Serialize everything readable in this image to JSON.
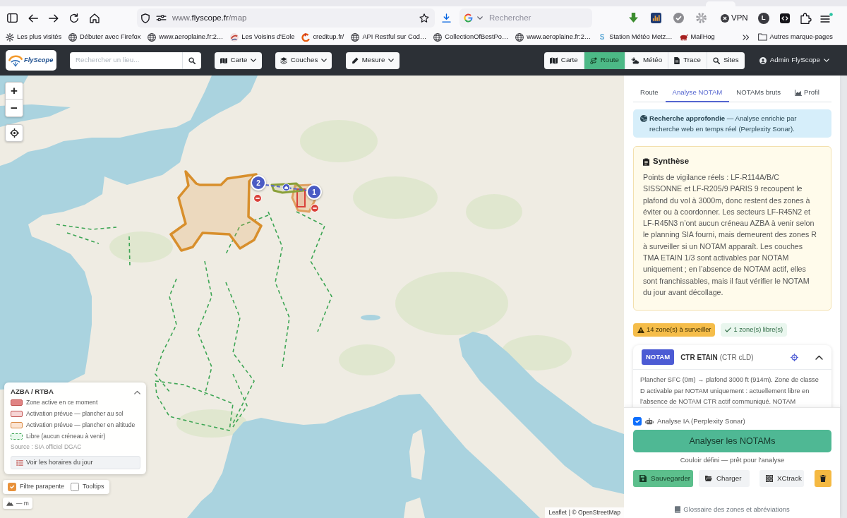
{
  "browser": {
    "url": {
      "prefix": "www.",
      "domain": "flyscope.fr",
      "path": "/map"
    },
    "search_placeholder": "Rechercher",
    "vpn_label": "VPN",
    "profile_initial": "L",
    "bookmarks": [
      {
        "label": "Les plus visités"
      },
      {
        "label": "Débuter avec Firefox"
      },
      {
        "label": "www.aeroplaine.fr:2…"
      },
      {
        "label": "Les Voisins d'Eole"
      },
      {
        "label": "creditup.fr/"
      },
      {
        "label": "API Restful sur Cod…"
      },
      {
        "label": "CollectionOfBestPo…"
      },
      {
        "label": "www.aeroplaine.fr:2…"
      },
      {
        "label": "Station Météo Metz…",
        "favicon_letter": "S"
      },
      {
        "label": "MailHog"
      }
    ],
    "other_bookmarks": "Autres marque-pages"
  },
  "navbar": {
    "logo_text": "FlyScope",
    "search_placeholder": "Rechercher un lieu...",
    "menus": [
      {
        "label": "Carte"
      },
      {
        "label": "Couches"
      },
      {
        "label": "Mesure"
      }
    ],
    "view_buttons": [
      {
        "label": "Carte",
        "selected": false
      },
      {
        "label": "Route",
        "selected": true
      },
      {
        "label": "Météo",
        "selected": false
      },
      {
        "label": "Trace",
        "selected": false
      },
      {
        "label": "Sites",
        "selected": false
      }
    ],
    "user": "Admin FlyScope"
  },
  "map": {
    "zoom_in": "+",
    "zoom_out": "−",
    "route_markers": [
      {
        "label": "2"
      },
      {
        "label": "1"
      }
    ],
    "legend": {
      "title": "AZBA / RTBA",
      "expanded": true,
      "items": [
        {
          "label": "Zone active en ce moment",
          "kind": "active"
        },
        {
          "label": "Activation prévue — plancher au sol",
          "kind": "ground"
        },
        {
          "label": "Activation prévue — plancher en altitude",
          "kind": "altitude"
        },
        {
          "label": "Libre (aucun créneau à venir)",
          "kind": "free"
        }
      ],
      "source": "Source : SIA officiel DGAC",
      "button": "Voir les horaires du jour"
    },
    "filters": [
      {
        "label": "Filtre parapente",
        "checked": true
      },
      {
        "label": "Tooltips",
        "checked": false
      }
    ],
    "altitude_readout": "— m",
    "attribution": {
      "link": "Leaflet",
      "text": "| © OpenStreetMap"
    }
  },
  "panel": {
    "tabs": [
      {
        "label": "Route",
        "selected": false
      },
      {
        "label": "Analyse NOTAM",
        "selected": true
      },
      {
        "label": "NOTAMs bruts",
        "selected": false
      },
      {
        "label": "Profil",
        "selected": false
      }
    ],
    "info": "**Recherche approfondie** — Analyse enrichie par recherche web en temps réel (Perplexity Sonar).",
    "synthesis": {
      "title": "Synthèse",
      "text": "Points de vigilance réels : LF-R114A/B/C SISSONNE et LF-R205/9 PARIS 9 recoupent le plafond du vol à 3000m, donc restent des zones à éviter ou à coordonner. Les secteurs LF-R45N2 et LF-R45N3 n’ont aucun créneau AZBA à venir selon le planning SIA fourni, mais demeurent des zones R à surveiller si un NOTAM apparaît. Les couches TMA ETAIN 1/3 sont activables par NOTAM uniquement ; en l’absence de NOTAM actif, elles sont franchissables, mais il faut vérifier le NOTAM du jour avant décollage."
    },
    "summary_badges": [
      {
        "label": "14 zone(s) à surveiller",
        "kind": "warning"
      },
      {
        "label": "1 zone(s) libre(s)",
        "kind": "free"
      }
    ],
    "notams": [
      {
        "type": "NOTAM",
        "name": "CTR ETAIN",
        "zone_class": "(CTR cLD)",
        "expanded": true,
        "text": "Plancher SFC (0m) → plafond 3000 ft (914m). Zone de classe D activable par NOTAM uniquement : actuellement libre en l’absence de NOTAM CTR actif communiqué. NOTAM"
      }
    ],
    "footer": {
      "ai_analysis": {
        "label": "Analyse IA (Perplexity Sonar)",
        "checked": true
      },
      "analyze_button": "Analyser les NOTAMs",
      "status": "Couloir défini — prêt pour l'analyse",
      "actions": [
        {
          "label": "Sauvegarder",
          "kind": "save"
        },
        {
          "label": "Charger",
          "kind": "load"
        },
        {
          "label": "XCtrack",
          "kind": "export"
        },
        {
          "kind": "delete"
        }
      ],
      "glossary": "Glossaire des zones et abréviations"
    }
  }
}
